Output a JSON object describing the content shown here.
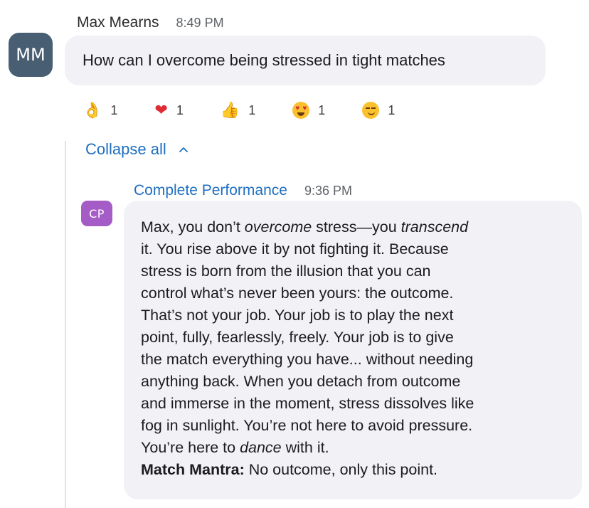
{
  "message": {
    "sender_initials": "MM",
    "sender": "Max Mearns",
    "time": "8:49 PM",
    "text": "How can I overcome being stressed in tight matches",
    "reactions": [
      {
        "emoji": "ok-hand",
        "count": "1"
      },
      {
        "emoji": "red-heart",
        "count": "1"
      },
      {
        "emoji": "thumbs-up",
        "count": "1"
      },
      {
        "emoji": "heart-eyes",
        "count": "1"
      },
      {
        "emoji": "smirk",
        "count": "1"
      }
    ]
  },
  "thread": {
    "collapse_label": "Collapse all"
  },
  "reply": {
    "sender_initials": "CP",
    "sender": "Complete Performance",
    "time": "9:36 PM",
    "l1a": "Max, you don’t ",
    "l1b": "overcome",
    "l1c": " stress—you ",
    "l1d": "transcend",
    "l2": "it. You rise above it by not fighting it. Because",
    "l3": "stress is born from the illusion that you can",
    "l4": "control what’s never been yours: the outcome.",
    "l5": "That’s not your job. Your job is to play the next",
    "l6": "point, fully, fearlessly, freely. Your job is to give",
    "l7": "the match everything you have... without needing",
    "l8": "anything back. When you detach from outcome",
    "l9": "and immerse in the moment, stress dissolves like",
    "l10": "fog in sunlight. You’re not here to avoid pressure.",
    "l11a": "You’re here to ",
    "l11b": "dance",
    "l11c": " with it.",
    "mantra_label": "Match Mantra:",
    "mantra_text": " No outcome, only this point."
  }
}
